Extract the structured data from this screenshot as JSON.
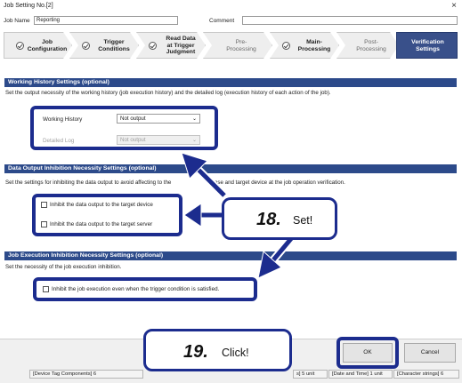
{
  "window": {
    "title": "Job Setting No.[2]",
    "close_glyph": "×"
  },
  "fields": {
    "job_name_label": "Job Name",
    "job_name_value": "Reporting",
    "comment_label": "Comment",
    "comment_value": ""
  },
  "steps": [
    {
      "label_line1": "Job",
      "label_line2": "Configuration",
      "label_line3": "",
      "checked": true
    },
    {
      "label_line1": "Trigger",
      "label_line2": "Conditions",
      "label_line3": "",
      "checked": true
    },
    {
      "label_line1": "Read Data",
      "label_line2": "at Trigger",
      "label_line3": "Judgment",
      "checked": true
    },
    {
      "label_line1": "Pre-",
      "label_line2": "Processing",
      "label_line3": "",
      "checked": false
    },
    {
      "label_line1": "Main-",
      "label_line2": "Processing",
      "label_line3": "",
      "checked": true
    },
    {
      "label_line1": "Post-",
      "label_line2": "Processing",
      "label_line3": "",
      "checked": false
    },
    {
      "label_line1": "Verification",
      "label_line2": "Settings",
      "label_line3": "",
      "checked": false,
      "active": true
    }
  ],
  "working_history": {
    "header": "Working History Settings (optional)",
    "desc": "Set the output necessity of the working history (job execution history) and the detailed log (execution history of each action of the job).",
    "history_label": "Working History",
    "history_value": "Not output",
    "detail_label": "Detailed Log",
    "detail_value": "Not output"
  },
  "data_output": {
    "header": "Data Output Inhibition Necessity Settings (optional)",
    "desc_left": "Set the settings for inhibiting the data output to avoid affecting t",
    "desc_mid": "o the ",
    "desc_right": "abase and target device at the job operation verification.",
    "cb_device": "Inhibit the data output to the target device",
    "cb_server": "Inhibit the data output to the target server"
  },
  "job_execution": {
    "header": "Job Execution Inhibition Necessity Settings (optional)",
    "desc": "Set the necessity of the job execution inhibition.",
    "cb_inhibit": "Inhibit the job execution even when the trigger condition is satisfied."
  },
  "callouts": {
    "step18_num": "18.",
    "step18_word": "Set!",
    "step19_num": "19.",
    "step19_word": "Click!"
  },
  "buttons": {
    "ok": "OK",
    "cancel": "Cancel"
  },
  "status": {
    "left": "[Device Tag Components] 6",
    "mid_1": "s] 5 unit",
    "mid_2": "[Date and Time] 1 unit",
    "right": "[Character strings] 6"
  },
  "colors": {
    "accent": "#1c2c8e",
    "section_bg": "#2c4a8a",
    "active_step": "#39508a"
  }
}
